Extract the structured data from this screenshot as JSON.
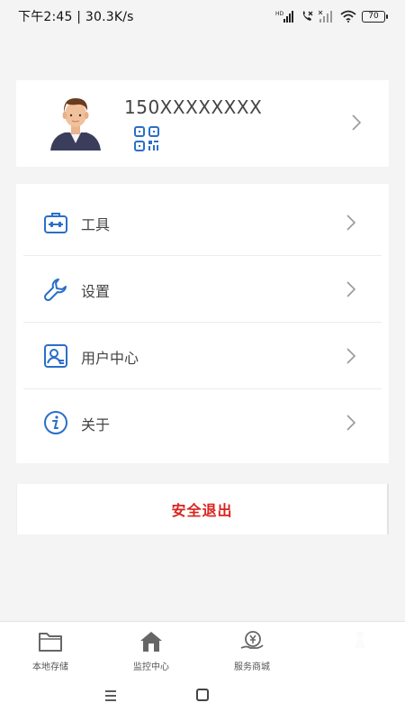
{
  "status_bar": {
    "time_speed": "下午2:45 | 30.3K/s",
    "battery": "70",
    "signal_label": "HD"
  },
  "profile": {
    "phone": "150XXXXXXXX"
  },
  "menu": {
    "items": [
      {
        "label": "工具",
        "icon": "toolbox-icon"
      },
      {
        "label": "设置",
        "icon": "wrench-icon"
      },
      {
        "label": "用户中心",
        "icon": "user-card-icon"
      },
      {
        "label": "关于",
        "icon": "info-icon"
      }
    ]
  },
  "logout": {
    "label": "安全退出"
  },
  "bottom_nav": {
    "tabs": [
      {
        "label": "本地存储",
        "icon": "folder-icon"
      },
      {
        "label": "监控中心",
        "icon": "home-icon"
      },
      {
        "label": "服务商城",
        "icon": "yuan-hand-icon"
      },
      {
        "label": "",
        "icon": "person-icon"
      }
    ]
  },
  "colors": {
    "accent": "#2a6fc7",
    "logout_red": "#d8231f",
    "background": "#f4f4f4"
  }
}
